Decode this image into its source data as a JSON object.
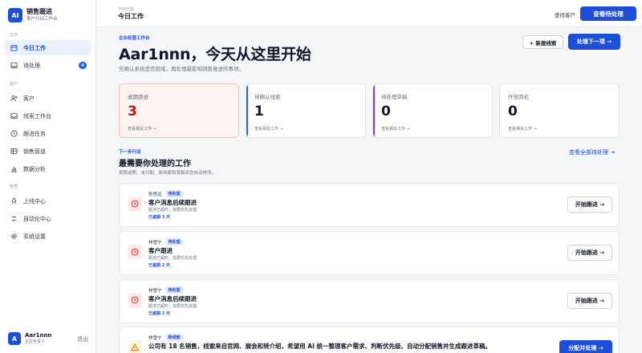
{
  "app": {
    "logo_text": "AI",
    "name": "销售跟进",
    "subtitle": "客户行动工作台"
  },
  "sidebar": {
    "sections": [
      "工作",
      "客户",
      "管理"
    ],
    "items": [
      {
        "label": "今日工作",
        "icon": "calendar-icon",
        "active": true
      },
      {
        "label": "待处理",
        "icon": "inbox-icon",
        "badge": "4"
      },
      {
        "label": "客户",
        "icon": "user-plus-icon"
      },
      {
        "label": "线索工作台",
        "icon": "inbox-icon"
      },
      {
        "label": "跟进任务",
        "icon": "clock-icon"
      },
      {
        "label": "销售管道",
        "icon": "pipeline-icon"
      },
      {
        "label": "数据分析",
        "icon": "bar-chart-icon"
      },
      {
        "label": "上线中心",
        "icon": "rocket-icon"
      },
      {
        "label": "自动化中心",
        "icon": "automation-icon"
      },
      {
        "label": "系统设置",
        "icon": "gear-icon"
      }
    ]
  },
  "user": {
    "avatar": "A",
    "name": "Aar1nnn",
    "role": "企业负责人",
    "logout": "退出"
  },
  "topbar": {
    "crumb": "当前位置",
    "title": "今日工作",
    "link": "查找客户",
    "button": "查看待处理"
  },
  "hero": {
    "eyebrow": "企业经营工作台",
    "title": "Aar1nnn，今天从这里开始",
    "subtitle": "先确认系统是否就绪，再处理最影响销售推进的事项。",
    "new_lead": "+ 新建线索",
    "next": "处理下一项 →"
  },
  "stats": [
    {
      "label": "逾期跟进",
      "value": "3",
      "link": "查看相关工作 →",
      "color": "#f5c6c0"
    },
    {
      "label": "待确认线索",
      "value": "1",
      "link": "查看相关工作 →",
      "color": "#2563eb"
    },
    {
      "label": "待处理草稿",
      "value": "0",
      "link": "查看相关工作 →",
      "color": "#7c3aed"
    },
    {
      "label": "开放商机",
      "value": "0",
      "link": "查看相关工作 →",
      "color": "#e5e7eb"
    }
  ],
  "next_section": {
    "eyebrow": "下一步行动",
    "title": "最需要你处理的工作",
    "subtitle": "按照逾期、未分配、新线索和草稿状态自动排序。",
    "link": "查看全部待处理 →"
  },
  "tasks": [
    {
      "owner": "陈思远",
      "tag": "待处理",
      "title": "客户消息后续跟进",
      "desc": "跟进已超时，需要优先处理",
      "overdue": "已逾期 3 天",
      "button": "开始跟进 →",
      "icon": "clock-icon"
    },
    {
      "owner": "林雪宁",
      "tag": "待处理",
      "title": "客户跟进",
      "desc": "跟进已超时，需要优先处理",
      "overdue": "已逾期 2 天",
      "button": "开始跟进 →",
      "icon": "clock-icon"
    },
    {
      "owner": "林雪宁",
      "tag": "待处理",
      "title": "客户消息后续跟进",
      "desc": "跟进已超时，需要优先处理",
      "overdue": "已逾期 2 天",
      "button": "开始跟进 →",
      "icon": "clock-icon"
    },
    {
      "owner": "林雪宁",
      "tag": "新线索",
      "title": "公司有 18 名销售，线索来自官网、展会和转介绍，希望用 AI 统一整理客户需求、判断优先级、自动分配销售并生成跟进草稿。",
      "desc": "",
      "overdue": "",
      "button": "分配并处理 →",
      "icon": "warning-icon"
    }
  ]
}
